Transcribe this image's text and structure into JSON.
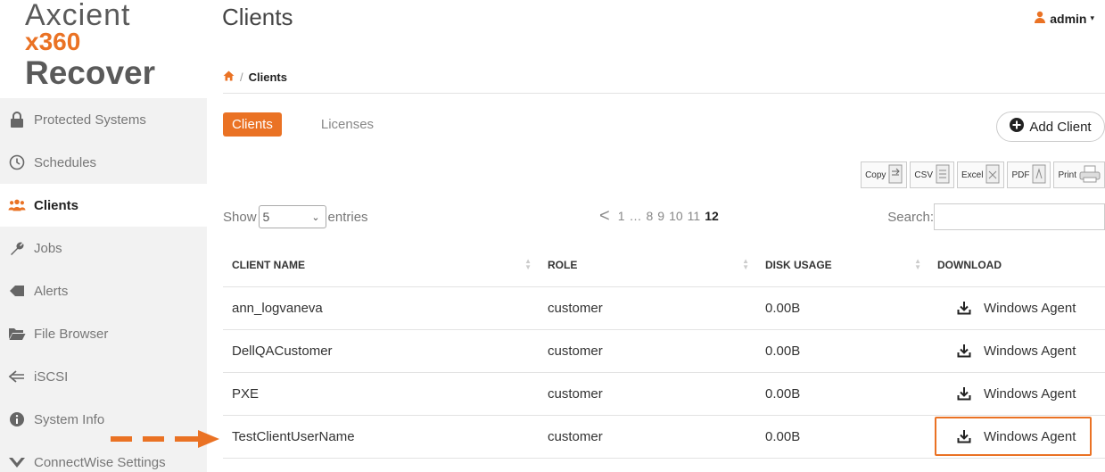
{
  "brand": {
    "line1": "Axcient",
    "line2": "x360",
    "line3": "Recover"
  },
  "sidebar": {
    "items": [
      {
        "label": "Protected Systems",
        "icon": "lock-icon"
      },
      {
        "label": "Schedules",
        "icon": "clock-icon"
      },
      {
        "label": "Clients",
        "icon": "users-icon",
        "active": true
      },
      {
        "label": "Jobs",
        "icon": "wrench-icon"
      },
      {
        "label": "Alerts",
        "icon": "tag-icon"
      },
      {
        "label": "File Browser",
        "icon": "folder-icon"
      },
      {
        "label": "iSCSI",
        "icon": "arrows-icon"
      },
      {
        "label": "System Info",
        "icon": "info-icon"
      },
      {
        "label": "ConnectWise Settings",
        "icon": "connectwise-icon"
      }
    ]
  },
  "header": {
    "title": "Clients",
    "user": "admin"
  },
  "breadcrumb": {
    "current": "Clients"
  },
  "tabs": [
    {
      "label": "Clients",
      "active": true
    },
    {
      "label": "Licenses",
      "active": false
    }
  ],
  "actions": {
    "add_client": "Add Client"
  },
  "export": {
    "copy": "Copy",
    "csv": "CSV",
    "excel": "Excel",
    "pdf": "PDF",
    "print": "Print"
  },
  "table_controls": {
    "show_label": "Show",
    "entries_value": "5",
    "entries_label": "entries",
    "search_label": "Search:",
    "pagination": {
      "first": "1",
      "ellipsis": "…",
      "pages": [
        "8",
        "9",
        "10",
        "11"
      ],
      "current": "12"
    }
  },
  "table": {
    "columns": [
      "CLIENT NAME",
      "ROLE",
      "DISK USAGE",
      "DOWNLOAD"
    ],
    "rows": [
      {
        "name": "ann_logvaneva",
        "role": "customer",
        "disk": "0.00B",
        "download": "Windows Agent"
      },
      {
        "name": "DellQACustomer",
        "role": "customer",
        "disk": "0.00B",
        "download": "Windows Agent"
      },
      {
        "name": "PXE",
        "role": "customer",
        "disk": "0.00B",
        "download": "Windows Agent"
      },
      {
        "name": "TestClientUserName",
        "role": "customer",
        "disk": "0.00B",
        "download": "Windows Agent"
      }
    ]
  },
  "colors": {
    "accent": "#ea7224",
    "sidebar_bg": "#f2f2f2"
  }
}
